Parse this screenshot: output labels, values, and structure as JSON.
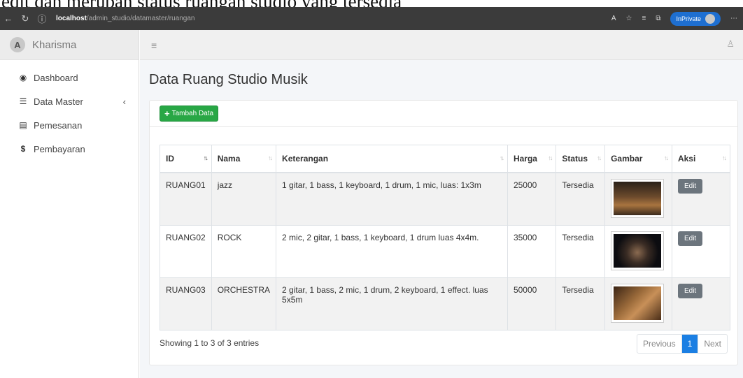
{
  "caption": "edit dan merubah status ruangan studio yang tersedia",
  "browser": {
    "url_host": "localhost",
    "url_path": "/admin_studio/datamaster/ruangan",
    "inprivate_label": "InPrivate"
  },
  "sidebar": {
    "brand": "Kharisma",
    "items": [
      {
        "label": "Dashboard",
        "icon": "dashboard-icon"
      },
      {
        "label": "Data Master",
        "icon": "database-icon"
      },
      {
        "label": "Pemesanan",
        "icon": "clipboard-icon"
      },
      {
        "label": "Pembayaran",
        "icon": "dollar-icon"
      }
    ]
  },
  "main": {
    "title": "Data Ruang Studio Musik",
    "add_button": "Tambah Data",
    "table": {
      "headers": [
        "ID",
        "Nama",
        "Keterangan",
        "Harga",
        "Status",
        "Gambar",
        "Aksi"
      ],
      "rows": [
        {
          "id": "RUANG01",
          "nama": "jazz",
          "keterangan": "1 gitar, 1 bass, 1 keyboard, 1 drum, 1 mic, luas: 1x3m",
          "harga": "25000",
          "status": "Tersedia",
          "aksi": "Edit"
        },
        {
          "id": "RUANG02",
          "nama": "ROCK",
          "keterangan": "2 mic, 2 gitar, 1 bass, 1 keyboard, 1 drum luas 4x4m.",
          "harga": "35000",
          "status": "Tersedia",
          "aksi": "Edit"
        },
        {
          "id": "RUANG03",
          "nama": "ORCHESTRA",
          "keterangan": "2 gitar, 1 bass, 2 mic, 1 drum, 2 keyboard, 1 effect. luas 5x5m",
          "harga": "50000",
          "status": "Tersedia",
          "aksi": "Edit"
        }
      ]
    },
    "info": "Showing 1 to 3 of 3 entries",
    "pager": {
      "previous": "Previous",
      "current": "1",
      "next": "Next"
    }
  },
  "colors": {
    "accent": "#1b7fe3",
    "add_button": "#28a745",
    "edit_button": "#6c757d"
  }
}
